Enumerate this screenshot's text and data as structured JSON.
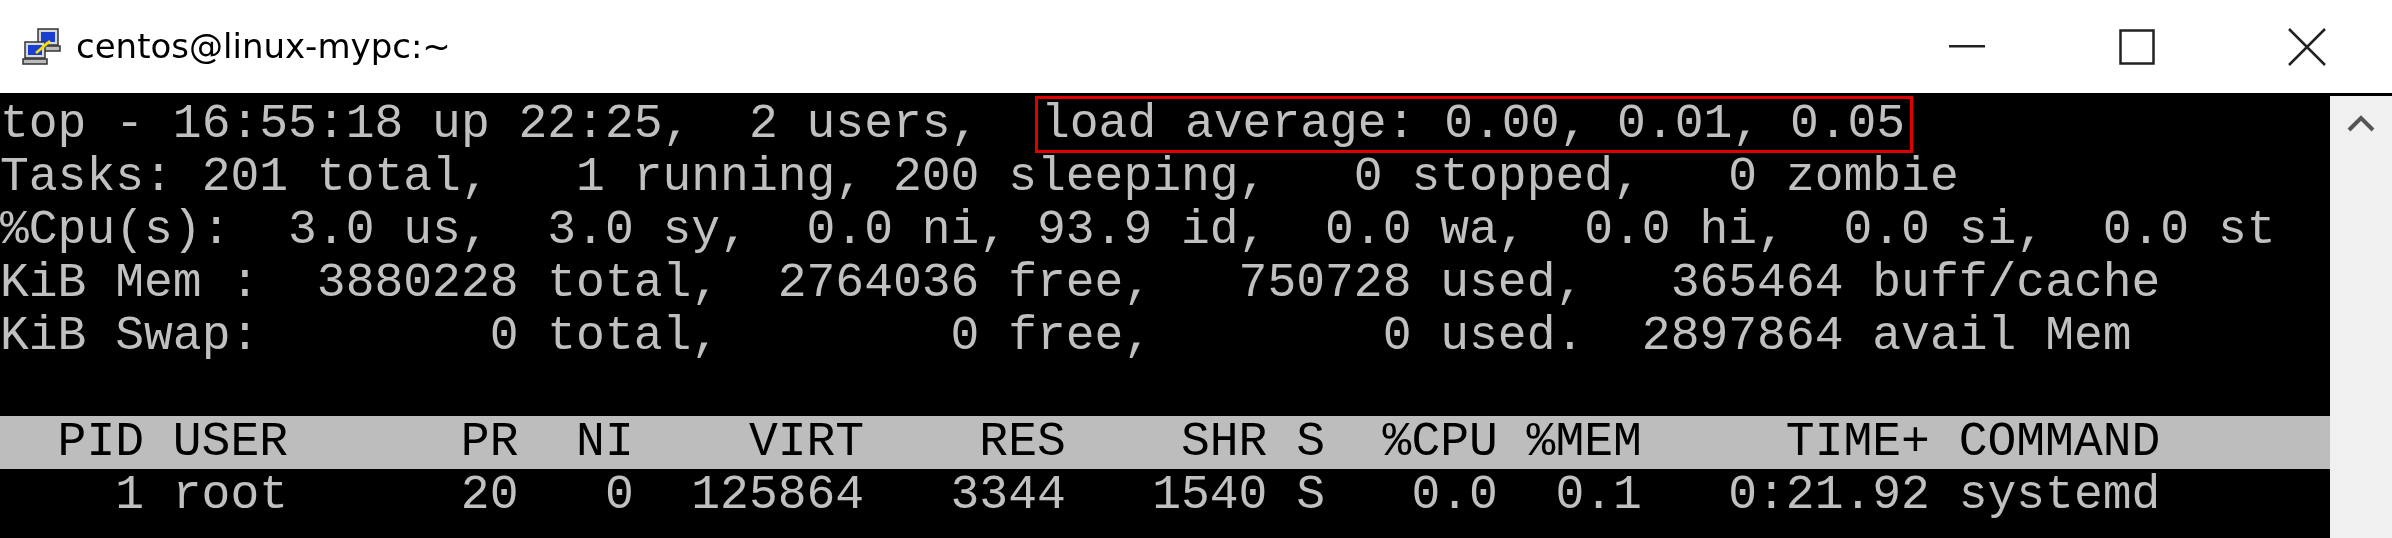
{
  "window": {
    "title": "centos@linux-mypc:~"
  },
  "summary_lines": [
    {
      "segments": [
        {
          "text": "top - 16:55:18 up 22:25,  2 users,  ",
          "highlighted": false
        },
        {
          "text": "load average: 0.00, 0.01, 0.05",
          "highlighted": true
        }
      ]
    },
    {
      "segments": [
        {
          "text": "Tasks: 201 total,   1 running, 200 sleeping,   0 stopped,   0 zombie",
          "highlighted": false
        }
      ]
    },
    {
      "segments": [
        {
          "text": "%Cpu(s):  3.0 us,  3.0 sy,  0.0 ni, 93.9 id,  0.0 wa,  0.0 hi,  0.0 si,  0.0 st",
          "highlighted": false
        }
      ]
    },
    {
      "segments": [
        {
          "text": "KiB Mem :  3880228 total,  2764036 free,   750728 used,   365464 buff/cache",
          "highlighted": false
        }
      ]
    },
    {
      "segments": [
        {
          "text": "KiB Swap:        0 total,        0 free,        0 used.  2897864 avail Mem",
          "highlighted": false
        }
      ]
    }
  ],
  "process_table": {
    "columns": [
      "PID",
      "USER",
      "PR",
      "NI",
      "VIRT",
      "RES",
      "SHR",
      "S",
      "%CPU",
      "%MEM",
      "TIME+",
      "COMMAND"
    ],
    "rows": [
      [
        "1",
        "root",
        "20",
        "0",
        "125864",
        "3344",
        "1540",
        "S",
        "0.0",
        "0.1",
        "0:21.92",
        "systemd"
      ]
    ]
  }
}
